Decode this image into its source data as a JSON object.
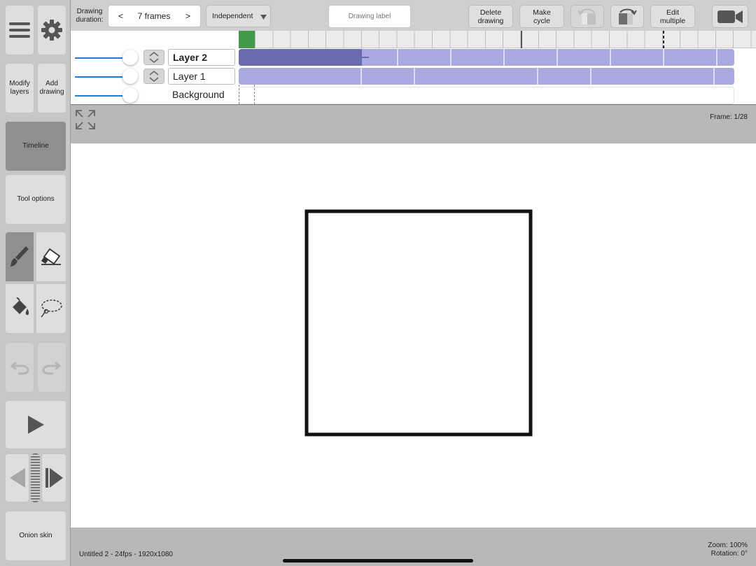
{
  "toolbar": {
    "duration_label": "Drawing duration:",
    "prev": "<",
    "frames": "7 frames",
    "next": ">",
    "mode": "Independent",
    "drawing_label_placeholder": "Drawing label",
    "delete_drawing": "Delete drawing",
    "make_cycle": "Make cycle",
    "edit_multiple": "Edit multiple"
  },
  "sidebar": {
    "modify_layers": "Modify layers",
    "add_drawing": "Add drawing",
    "timeline": "Timeline",
    "tool_options": "Tool options",
    "onion_skin": "Onion skin"
  },
  "layers": [
    {
      "name": "Layer 2"
    },
    {
      "name": "Layer 1"
    },
    {
      "name": "Background"
    }
  ],
  "canvas": {
    "frame_indicator": "Frame: 1/28",
    "file_info": "Untitled 2 - 24fps - 1920x1080",
    "zoom": "Zoom: 100%",
    "rotation": "Rotation: 0°"
  },
  "colors": {
    "accent_blue": "#1f7ad8",
    "frame_selected": "#6a6ab0",
    "frame_fill": "#a9a9e0",
    "current_frame_marker": "#3f9a4a"
  }
}
